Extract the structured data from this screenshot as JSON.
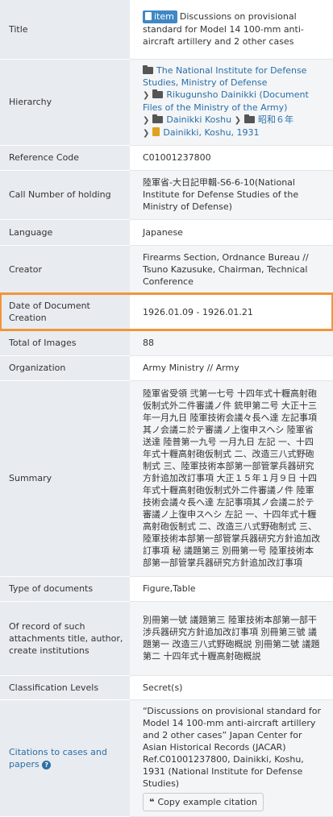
{
  "title": {
    "key": "Title",
    "badge": "item",
    "text": "Discussions on provisional standard for Model 14 100-mm anti-aircraft artillery and 2 other cases"
  },
  "hierarchy": {
    "key": "Hierarchy",
    "items": [
      "The National Institute for Defense Studies, Ministry of Defense",
      "Rikugunsho Dainikki (Document Files of the Ministry of the Army)",
      "Dainikki Koshu",
      "昭和６年",
      "Dainikki, Koshu, 1931"
    ]
  },
  "reference_code": {
    "key": "Reference Code",
    "value": "C01001237800"
  },
  "call_number": {
    "key": "Call Number of holding",
    "value": "陸軍省-大日記甲輯-S6-6-10(National Institute for Defense Studies of the Ministry of Defense)"
  },
  "language": {
    "key": "Language",
    "value": "Japanese"
  },
  "creator": {
    "key": "Creator",
    "value": "Firearms Section, Ordnance Bureau // Tsuno Kazusuke, Chairman, Technical Conference"
  },
  "date": {
    "key": "Date of Document Creation",
    "value": "1926.01.09 - 1926.01.21"
  },
  "total_images": {
    "key": "Total of Images",
    "value": "88"
  },
  "organization": {
    "key": "Organization",
    "value": "Army Ministry // Army"
  },
  "summary": {
    "key": "Summary",
    "value": "陸軍省受領 弐第一七号 十四年式十糎高射砲仮制式外二件審議ノ件 銃甲第二号 大正十三年一月九日 陸軍技術会議々長へ達 左記事項其ノ会議ニ於テ審議ノ上復申スヘシ 陸軍省送達 陸普第一九号 一月九日 左記 一、十四年式十糎高射砲仮制式 二、改造三八式野砲制式 三、陸軍技術本部第一部管掌兵器研究方針追加改訂事項 大正１５年１月９日 十四年式十糎高射砲仮制式外二件審議ノ件 陸軍技術会議々長へ達 左記事項其ノ会議ニ於テ審議ノ上復申スヘシ 左記 一、十四年式十糎高射砲仮制式 二、改造三八式野砲制式 三、陸軍技術本部第一部管掌兵器研究方針追加改訂事項 秘 議題第三 別冊第一号 陸軍技術本部第一部管掌兵器研究方針追加改訂事項"
  },
  "type_docs": {
    "key": "Type of documents",
    "value": "Figure,Table"
  },
  "attachments": {
    "key": "Of record of such attachments title, author, create institutions",
    "value": "別冊第一號 議題第三 陸軍技術本部第一部干涉兵器研究方針追加改訂事項 別冊第三號 議題第一 改造三八式野砲概説 別冊第二號 議題第二 十四年式十糎高射砲概説"
  },
  "classification": {
    "key": "Classification Levels",
    "value": "Secret(s)"
  },
  "citations": {
    "key": "Citations to cases and papers",
    "value": "“Discussions on provisional standard for Model 14 100-mm anti-aircraft artillery and 2 other cases” Japan Center for Asian Historical Records (JACAR) Ref.C01001237800, Dainikki, Koshu, 1931 (National Institute for Defense Studies)",
    "button": "Copy example citation"
  }
}
